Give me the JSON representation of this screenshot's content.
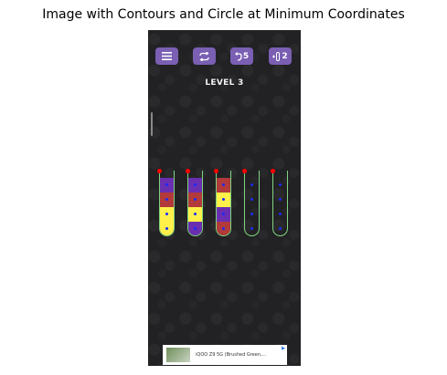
{
  "figure": {
    "title": "Image with Contours and Circle at Minimum Coordinates"
  },
  "toolbar": {
    "menu_icon": "hamburger-menu-icon",
    "restart_icon": "restart-arrows-icon",
    "undo_icon": "undo-arrow-icon",
    "undo_count": "5",
    "add_tube_icon": "add-tube-icon",
    "add_tube_count": "2",
    "button_color": "#7a5fb3"
  },
  "game": {
    "level_label": "LEVEL 3",
    "colors": {
      "purple": "#6a2fb0",
      "red": "#b23a3a",
      "yellow": "#fff04a",
      "outline": "#7fd37f",
      "dot": "#1a2bff",
      "marker": "#ff0000"
    },
    "tubes": [
      {
        "segments": [
          "purple",
          "red",
          "yellow",
          "yellow"
        ]
      },
      {
        "segments": [
          "purple",
          "red",
          "yellow",
          "purple"
        ]
      },
      {
        "segments": [
          "red",
          "yellow",
          "purple",
          "red"
        ]
      },
      {
        "segments": []
      },
      {
        "segments": []
      }
    ]
  },
  "ad": {
    "text": "iQOO Z9 5G (Brushed Green,..."
  }
}
